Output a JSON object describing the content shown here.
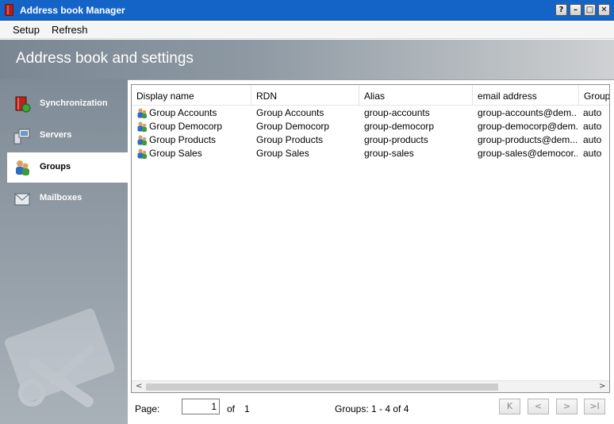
{
  "window": {
    "title": "Address book Manager",
    "buttons": {
      "help": "?",
      "minimize": "–",
      "maximize": "□",
      "close": "✕"
    }
  },
  "menu": {
    "setup": "Setup",
    "refresh": "Refresh"
  },
  "header": {
    "title": "Address book and settings"
  },
  "sidebar": {
    "items": [
      {
        "label": "Synchronization",
        "icon": "sync-book-icon",
        "active": false
      },
      {
        "label": "Servers",
        "icon": "servers-icon",
        "active": false
      },
      {
        "label": "Groups",
        "icon": "groups-icon",
        "active": true
      },
      {
        "label": "Mailboxes",
        "icon": "mailboxes-icon",
        "active": false
      }
    ]
  },
  "grid": {
    "columns": [
      "Display name",
      "RDN",
      "Alias",
      "email address",
      "Group"
    ],
    "rows": [
      {
        "display_name": "Group Accounts",
        "rdn": "Group Accounts",
        "alias": "group-accounts",
        "email": "group-accounts@dem...",
        "group": "auto"
      },
      {
        "display_name": "Group Democorp",
        "rdn": "Group Democorp",
        "alias": "group-democorp",
        "email": "group-democorp@dem...",
        "group": "auto"
      },
      {
        "display_name": "Group Products",
        "rdn": "Group Products",
        "alias": "group-products",
        "email": "group-products@dem...",
        "group": "auto"
      },
      {
        "display_name": "Group Sales",
        "rdn": "Group Sales",
        "alias": "group-sales",
        "email": "group-sales@democor...",
        "group": "auto"
      }
    ]
  },
  "pager": {
    "page_label": "Page:",
    "page_value": "1",
    "of_label": "of",
    "total_pages": "1",
    "summary": "Groups: 1 - 4 of 4",
    "first": "K",
    "prev": "<",
    "next": ">",
    "last": ">I"
  },
  "colors": {
    "titlebar": "#1464c8",
    "sidebar": "#8f9aa4",
    "header_start": "#7a8793",
    "header_end": "#cfd1d3"
  }
}
